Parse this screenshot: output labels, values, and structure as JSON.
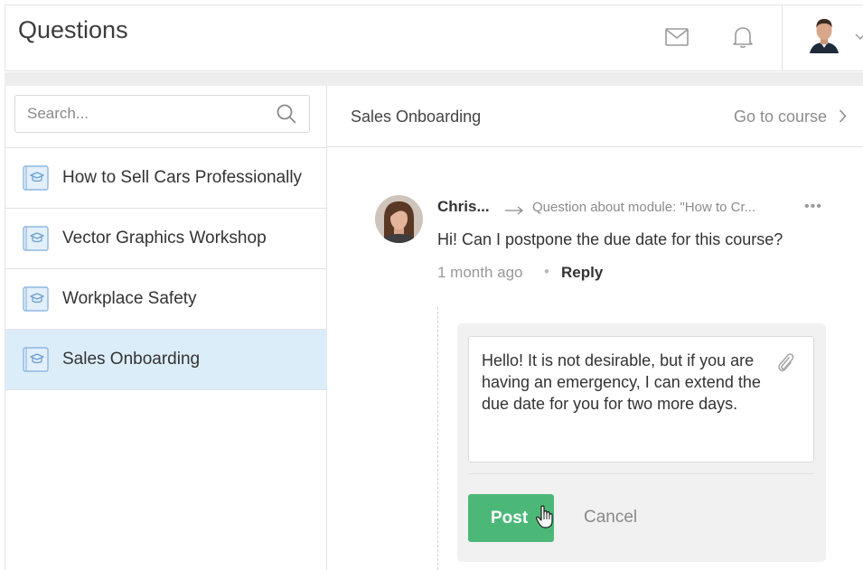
{
  "header": {
    "title": "Questions",
    "icons": [
      "mail-icon",
      "bell-icon",
      "chevron-down-icon"
    ]
  },
  "sidebar": {
    "search_placeholder": "Search...",
    "items": [
      {
        "label": "How to Sell Cars Professionally",
        "active": false
      },
      {
        "label": "Vector Graphics Workshop",
        "active": false
      },
      {
        "label": "Workplace Safety",
        "active": false
      },
      {
        "label": "Sales Onboarding",
        "active": true
      }
    ]
  },
  "main": {
    "course_title": "Sales Onboarding",
    "go_to_course": "Go to course",
    "comment": {
      "author": "Chris...",
      "context": "Question about module: \"How to Cr...",
      "more": "•••",
      "body": "Hi! Can I postpone the due date for this course?",
      "time": "1 month ago",
      "separator": "•",
      "reply_label": "Reply"
    },
    "reply": {
      "text": "Hello! It is not desirable, but if you are having an emergency,  I can extend the due date for you for two more days.",
      "post_label": "Post",
      "cancel_label": "Cancel"
    }
  },
  "colors": {
    "active_item_bg": "#dcedfa",
    "post_button": "#4cb877",
    "course_icon": "#7aa9d8"
  }
}
